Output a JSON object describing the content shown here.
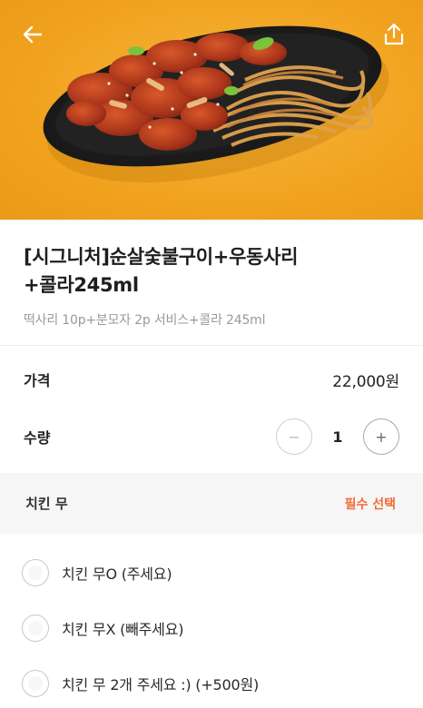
{
  "header": {
    "back_icon": "arrow-left-icon",
    "share_icon": "share-icon"
  },
  "product": {
    "title": "[시그니처]순살숯불구이+우동사리\n+콜라245ml",
    "title_line1": "[시그니처]순살숯불구이+우동사리",
    "title_line2": "+콜라245ml",
    "description": "떡사리 10p+분모자 2p 서비스+콜라 245ml"
  },
  "price": {
    "label": "가격",
    "value": "22,000원"
  },
  "quantity": {
    "label": "수량",
    "value": "1",
    "minus_label": "−",
    "plus_label": "+"
  },
  "option_group": {
    "title": "치킨 무",
    "badge": "필수 선택",
    "badge_color": "#f26b3a",
    "items": [
      {
        "label": "치킨 무O (주세요)"
      },
      {
        "label": "치킨 무X (빼주세요)"
      },
      {
        "label": "치킨 무 2개 주세요 :) (+500원)"
      }
    ]
  },
  "colors": {
    "hero_background": "#f1a320",
    "plate": "#1f1f1f"
  }
}
